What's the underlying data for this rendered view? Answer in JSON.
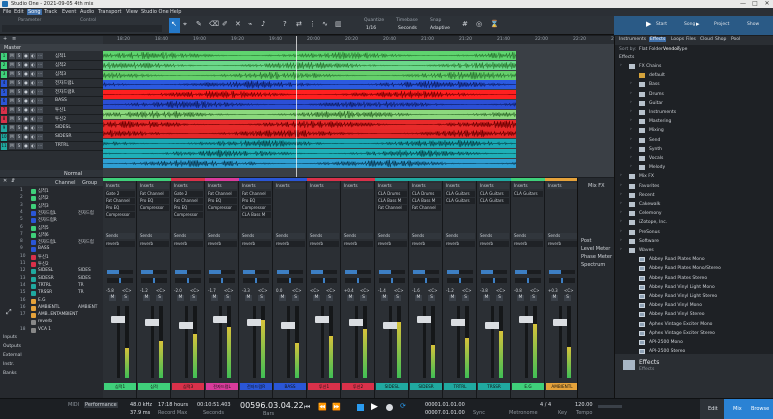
{
  "window": {
    "title": "Studio One - 2021-09-05 4th mix",
    "min": "—",
    "max": "□",
    "close": "✕"
  },
  "menu": [
    "File",
    "Edit",
    "Song",
    "Track",
    "Event",
    "Audio",
    "Transport",
    "View",
    "Studio One",
    "Help"
  ],
  "toolbar": {
    "parameter_label": "Parameter",
    "control_label": "Control",
    "quantize_label": "Quantize",
    "quantize_value": "1/16",
    "timebase_label": "Timebase",
    "timebase_value": "Seconds",
    "snap_label": "Snap",
    "snap_value": "Adaptive",
    "start": "Start",
    "song": "Song",
    "project": "Project",
    "show": "Show"
  },
  "tracklist": {
    "master": "Master",
    "tracks": [
      {
        "num": "1",
        "name": "심적1",
        "color": "#3fd07a"
      },
      {
        "num": "2",
        "name": "심적2",
        "color": "#3fd07a"
      },
      {
        "num": "3",
        "name": "심적3",
        "color": "#3fd07a"
      },
      {
        "num": "4",
        "name": "전자드럼L",
        "color": "#2a56d6"
      },
      {
        "num": "5",
        "name": "전자드럼R",
        "color": "#2a56d6"
      },
      {
        "num": "6",
        "name": "BASS",
        "color": "#2a56d6"
      },
      {
        "num": "7",
        "name": "투신1",
        "color": "#d9314a"
      },
      {
        "num": "8",
        "name": "투신2",
        "color": "#d9314a"
      },
      {
        "num": "9",
        "name": "SIDESL",
        "color": "#20a9a0"
      },
      {
        "num": "10",
        "name": "SIDESR",
        "color": "#20a9a0"
      },
      {
        "num": "11",
        "name": "TRTRL",
        "color": "#20a9a0"
      }
    ],
    "normal": "Normal"
  },
  "ruler": [
    "18:20",
    "18:40",
    "19:00",
    "19:20",
    "19:40",
    "20:00",
    "20:20",
    "20:40",
    "21:00",
    "21:20",
    "21:40",
    "22:00",
    "22:20",
    "22:40"
  ],
  "lanes": [
    {
      "color": "#5fd46f",
      "wave": "#2c7a33"
    },
    {
      "color": "#6bd88a",
      "wave": "#2c7a33"
    },
    {
      "color": "#66d06c",
      "wave": "#2c7a33"
    },
    {
      "color": "#2b5ae0",
      "wave": "#0d1e66"
    },
    {
      "color": "#ff2020",
      "wave": "#7a0000"
    },
    {
      "color": "#2b4fd6",
      "wave": "#0d1e66"
    },
    {
      "color": "#8cd97e",
      "wave": "#2f6b2a"
    },
    {
      "color": "#e82a2a",
      "wave": "#6e0000"
    },
    {
      "color": "#e62828",
      "wave": "#6e0000"
    },
    {
      "color": "#1ba9b5",
      "wave": "#07464d"
    },
    {
      "color": "#1fb0b8",
      "wave": "#07464d"
    },
    {
      "color": "#2f9fd3",
      "wave": "#0a3a55"
    }
  ],
  "browser": {
    "tabs": [
      "Instruments",
      "Effects",
      "Loops",
      "Files",
      "Cloud",
      "Shop",
      "Pool"
    ],
    "sort_label": "Sort by:",
    "sort_options": [
      "Flat",
      "Folder",
      "Vendor",
      "Type"
    ],
    "section": "Effects",
    "tree": [
      {
        "name": "FX Chains",
        "level": 0,
        "type": "folder"
      },
      {
        "name": "default",
        "level": 1,
        "type": "item"
      },
      {
        "name": "Bass",
        "level": 1,
        "type": "folder"
      },
      {
        "name": "Drums",
        "level": 1,
        "type": "folder"
      },
      {
        "name": "Guitar",
        "level": 1,
        "type": "folder"
      },
      {
        "name": "Instruments",
        "level": 1,
        "type": "folder"
      },
      {
        "name": "Mastering",
        "level": 1,
        "type": "folder"
      },
      {
        "name": "Mixing",
        "level": 1,
        "type": "folder"
      },
      {
        "name": "Send",
        "level": 1,
        "type": "folder"
      },
      {
        "name": "Synth",
        "level": 1,
        "type": "folder"
      },
      {
        "name": "Vocals",
        "level": 1,
        "type": "folder"
      },
      {
        "name": "Melody",
        "level": 1,
        "type": "folder"
      },
      {
        "name": "Mix FX",
        "level": 0,
        "type": "folder"
      },
      {
        "name": "Favorites",
        "level": 0,
        "type": "folder"
      },
      {
        "name": "Recent",
        "level": 0,
        "type": "folder"
      },
      {
        "name": "Cakewalk",
        "level": 0,
        "type": "folder"
      },
      {
        "name": "Celemony",
        "level": 0,
        "type": "folder"
      },
      {
        "name": "iZotope, Inc.",
        "level": 0,
        "type": "folder"
      },
      {
        "name": "PreSonus",
        "level": 0,
        "type": "folder"
      },
      {
        "name": "Software",
        "level": 0,
        "type": "folder"
      },
      {
        "name": "Waves",
        "level": 0,
        "type": "folder"
      },
      {
        "name": "Abbey Road Plates Mono",
        "level": 1,
        "type": "plugin"
      },
      {
        "name": "Abbey Road Plates Mono/Stereo",
        "level": 1,
        "type": "plugin"
      },
      {
        "name": "Abbey Road Plates Stereo",
        "level": 1,
        "type": "plugin"
      },
      {
        "name": "Abbey Road Vinyl Light Mono",
        "level": 1,
        "type": "plugin"
      },
      {
        "name": "Abbey Road Vinyl Light Stereo",
        "level": 1,
        "type": "plugin"
      },
      {
        "name": "Abbey Road Vinyl Mono",
        "level": 1,
        "type": "plugin"
      },
      {
        "name": "Abbey Road Vinyl Stereo",
        "level": 1,
        "type": "plugin"
      },
      {
        "name": "Aphex Vintage Exciter Mono",
        "level": 1,
        "type": "plugin"
      },
      {
        "name": "Aphex Vintage Exciter Stereo",
        "level": 1,
        "type": "plugin"
      },
      {
        "name": "API-2500 Mono",
        "level": 1,
        "type": "plugin"
      },
      {
        "name": "API-2500 Stereo",
        "level": 1,
        "type": "plugin"
      }
    ],
    "footer_title": "Effects",
    "footer_sub": "Effects"
  },
  "mixlist": {
    "header": [
      "Channel",
      "Group"
    ],
    "rows": [
      {
        "num": "1",
        "name": "심적1",
        "color": "#3fd07a"
      },
      {
        "num": "2",
        "name": "심적2",
        "color": "#3fd07a"
      },
      {
        "num": "3",
        "name": "심적3",
        "color": "#3fd07a"
      },
      {
        "num": "4",
        "name": "전자드럼L",
        "name2": "전자드럼",
        "color": "#2a56d6"
      },
      {
        "num": "5",
        "name": "전자드럼R",
        "color": "#2a56d6"
      },
      {
        "num": "6",
        "name": "심적5",
        "color": "#3fd07a"
      },
      {
        "num": "7",
        "name": "심적6",
        "color": "#3fd07a"
      },
      {
        "num": "8",
        "name": "전자드럼L",
        "name2": "전자드럼",
        "color": "#2a56d6"
      },
      {
        "num": "9",
        "name": "BASS",
        "color": "#2a56d6"
      },
      {
        "num": "10",
        "name": "투신1",
        "color": "#d9314a"
      },
      {
        "num": "11",
        "name": "투신2",
        "color": "#d9314a"
      },
      {
        "num": "12",
        "name": "SIDESL",
        "name2": "SIDES",
        "color": "#20a9a0"
      },
      {
        "num": "13",
        "name": "SIDESR",
        "name2": "SIDES",
        "color": "#20a9a0"
      },
      {
        "num": "14",
        "name": "TRTRL",
        "name2": "TR",
        "color": "#20a9a0"
      },
      {
        "num": "15",
        "name": "TRSSR",
        "name2": "TR",
        "color": "#20a9a0"
      },
      {
        "num": "16",
        "name": "E.G",
        "color": "#e5a23a"
      },
      {
        "num": "16",
        "name": "AMBIENTL",
        "name2": "AMBIENT",
        "color": "#e5a23a"
      },
      {
        "num": "17",
        "name": "AMB..ENTAMBIENT",
        "color": "#e5a23a"
      },
      {
        "num": "",
        "name": "reverb",
        "color": "#888888"
      },
      {
        "num": "18",
        "name": "VCA 1",
        "color": "#888888"
      }
    ],
    "side": [
      "Inputs",
      "Outputs",
      "External",
      "Instr.",
      "Banks"
    ]
  },
  "channels": [
    {
      "label": "심적1",
      "color": "#3fd07a",
      "inserts": [
        "Gate 2",
        "Fat Channel",
        "Pro EQ",
        "Compressor"
      ],
      "val": "-5.8",
      "pan": "<C>"
    },
    {
      "label": "심적",
      "color": "#3fd07a",
      "inserts": [
        "Fat Channel",
        "Pro EQ",
        "Compressor"
      ],
      "val": "-1.2",
      "pan": "<C>"
    },
    {
      "label": "심적3",
      "color": "#d9314a",
      "inserts": [
        "Gate 2",
        "Fat Channel",
        "Pro EQ",
        "Compressor"
      ],
      "val": "-2.0",
      "pan": "<C>"
    },
    {
      "label": "전자드럼L",
      "color": "#d93b9b",
      "inserts": [
        "Fat Channel",
        "Pro EQ",
        "Compressor"
      ],
      "val": "-1.7",
      "pan": "<C>"
    },
    {
      "label": "전자드럼R",
      "color": "#2a56d6",
      "inserts": [
        "Fat Channel",
        "Pro EQ",
        "Compressor",
        "CLA Bass M"
      ],
      "val": "-3.3",
      "pan": "<C>"
    },
    {
      "label": "BASS",
      "color": "#2a56d6",
      "inserts": [],
      "val": "0.0",
      "pan": "<C>"
    },
    {
      "label": "투신1",
      "color": "#d9314a",
      "inserts": [],
      "val": "<C>",
      "pan": "<C>"
    },
    {
      "label": "투신2",
      "color": "#d9314a",
      "inserts": [],
      "val": "+0.4",
      "pan": "<C>"
    },
    {
      "label": "SIDESL",
      "color": "#20a9a0",
      "inserts": [
        "CLA Drums",
        "CLA Bass M",
        "Fat Channel"
      ],
      "val": "-1.4",
      "pan": "<C>"
    },
    {
      "label": "SIDESR",
      "color": "#20a9a0",
      "inserts": [
        "CLA Drums",
        "CLA Bass M",
        "Fat Channel"
      ],
      "val": "-1.6",
      "pan": "<C>"
    },
    {
      "label": "TRTRL",
      "color": "#20a9a0",
      "inserts": [
        "CLA Guitars",
        "CLA Guitars"
      ],
      "val": "-1.2",
      "pan": "<C>"
    },
    {
      "label": "TRSSR",
      "color": "#20a9a0",
      "inserts": [
        "CLA Guitars",
        "CLA Guitars"
      ],
      "val": "-3.8",
      "pan": "<C>"
    },
    {
      "label": "E.G",
      "color": "#3fd07a",
      "inserts": [
        "CLA Guitars"
      ],
      "val": "-0.8",
      "pan": "<C>"
    },
    {
      "label": "AMBIENTL",
      "color": "#e5a23a",
      "inserts": [],
      "val": "+0.3",
      "pan": "<C>"
    },
    {
      "label": "AMB..R",
      "color": "#e5a23a",
      "inserts": [],
      "val": "+0.4",
      "pan": "<C>"
    },
    {
      "label": "Main",
      "color": "#cccccc",
      "inserts": [
        "Fat Channel",
        "Pro EQ",
        "Compressor"
      ],
      "val": "0.0",
      "pan": "<C>"
    }
  ],
  "mixer_labels": {
    "inserts": "Inserts",
    "sends": "Sends",
    "reverb": "reverb",
    "mix_fx": "Mix FX",
    "m": "M",
    "s": "S",
    "post": "Post",
    "level_meter": "Level Meter",
    "phase_meter": "Phase Meter",
    "spectrum": "Spectrum"
  },
  "status": {
    "midi": "MIDI",
    "performance": "Performance",
    "sample_rate": "48.0 kHz",
    "latency": "37.9 ms",
    "record_max": "17:18 hours",
    "record_max_label": "Record Max",
    "seconds_val": "00:10:51.403",
    "seconds_label": "Seconds",
    "bars_val": "00596.03.04.22",
    "bars_label": "Bars",
    "loop_start": "00001.01.01.00",
    "loop_end": "00007.01.01.00",
    "sync": "Sync",
    "metronome": "Metronome",
    "timing": "4 / 4",
    "key": "Key",
    "tempo_val": "120.00",
    "tempo_label": "Tempo",
    "edit": "Edit",
    "mix": "Mix",
    "browse": "Browse"
  }
}
